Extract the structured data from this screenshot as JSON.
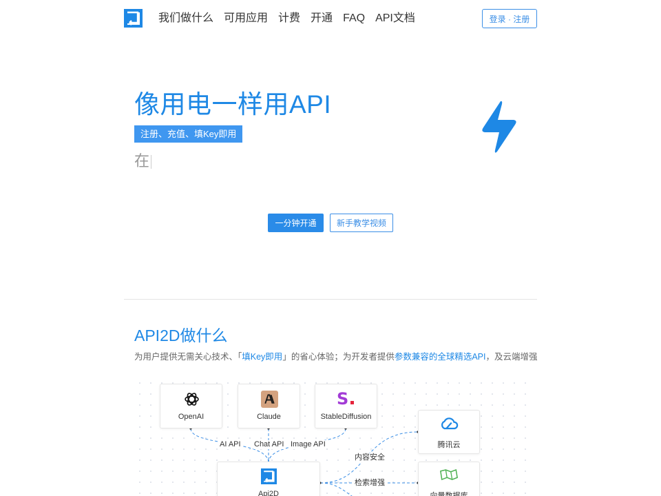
{
  "header": {
    "nav": [
      "我们做什么",
      "可用应用",
      "计费",
      "开通",
      "FAQ",
      "API文档"
    ],
    "login": "登录 · 注册"
  },
  "hero": {
    "title": "像用电一样用API",
    "badge": "注册、充值、填Key即用",
    "typing": "在",
    "primary_button": "一分钟开通",
    "secondary_button": "新手教学视频"
  },
  "section": {
    "title": "API2D做什么",
    "desc_1": "为用户提供无需关心技术、「",
    "desc_hl_1": "填Key即用",
    "desc_2": "」的省心体验；为开发者提供",
    "desc_hl_2": "参数兼容的全球精选API",
    "desc_3": "，及云端增强"
  },
  "diagram": {
    "nodes": {
      "openai": "OpenAI",
      "claude": "Claude",
      "stable": "StableDiffusion",
      "tencent": "腾讯云",
      "api2d": "Api2D",
      "vector": "向量数据库"
    },
    "edges": {
      "ai_api": "AI API",
      "chat_api": "Chat API",
      "image_api": "Image API",
      "content_safety": "内容安全",
      "retrieval": "检索增强"
    }
  },
  "colors": {
    "brand": "#1e88e5",
    "button": "#2a8be8",
    "badge": "#3f97f0",
    "stable_purple": "#a23bd6",
    "stable_red": "#e5243b",
    "claude_bg": "#d4a27f"
  }
}
